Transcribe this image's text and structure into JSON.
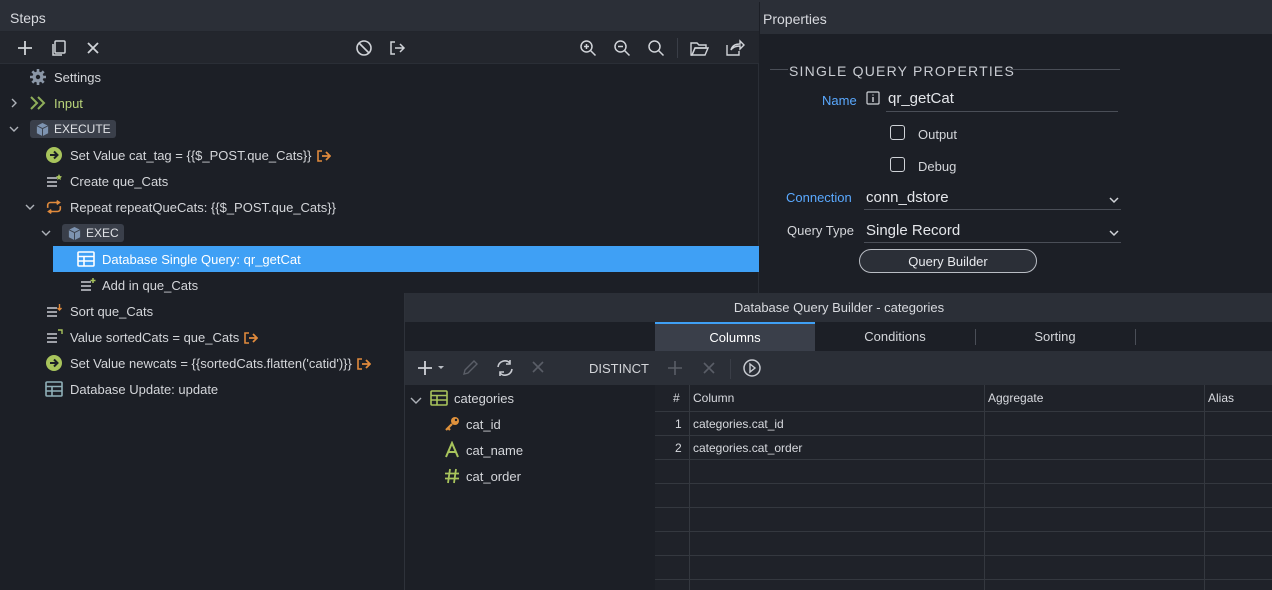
{
  "steps_panel": {
    "title": "Steps",
    "items": [
      {
        "label": "Settings"
      },
      {
        "label": "Input"
      },
      {
        "label": "EXECUTE"
      },
      {
        "label": "Set Value cat_tag = {{$_POST.que_Cats}}"
      },
      {
        "label": "Create que_Cats"
      },
      {
        "label": "Repeat repeatQueCats: {{$_POST.que_Cats}}"
      },
      {
        "label": "EXEC"
      },
      {
        "label": "Database Single Query: qr_getCat"
      },
      {
        "label": "Add in que_Cats"
      },
      {
        "label": "Sort que_Cats"
      },
      {
        "label": "Value sortedCats = que_Cats"
      },
      {
        "label": "Set Value newcats = {{sortedCats.flatten('catid')}}"
      },
      {
        "label": "Database Update: update"
      }
    ]
  },
  "properties_panel": {
    "title": "Properties",
    "section_title": "SINGLE QUERY PROPERTIES",
    "name_label": "Name",
    "name_value": "qr_getCat",
    "output_label": "Output",
    "debug_label": "Debug",
    "connection_label": "Connection",
    "connection_value": "conn_dstore",
    "query_type_label": "Query Type",
    "query_type_value": "Single Record",
    "query_builder_button": "Query Builder"
  },
  "query_builder": {
    "title": "Database Query Builder - categories",
    "tabs": [
      "Columns",
      "Conditions",
      "Sorting"
    ],
    "active_tab": "Columns",
    "distinct_label": "DISTINCT",
    "tree": {
      "table": "categories",
      "fields": [
        "cat_id",
        "cat_name",
        "cat_order"
      ]
    },
    "grid": {
      "headers": [
        "#",
        "Column",
        "Aggregate",
        "Alias"
      ],
      "rows": [
        {
          "num": "1",
          "column": "categories.cat_id",
          "aggregate": "",
          "alias": ""
        },
        {
          "num": "2",
          "column": "categories.cat_order",
          "aggregate": "",
          "alias": ""
        }
      ]
    }
  },
  "colors": {
    "selection": "#3fa0f5",
    "accent_blue": "#5aa9ff",
    "green_icon": "#8fae5a",
    "orange_icon": "#e08a3c",
    "panel_bg": "#1c1f26"
  }
}
